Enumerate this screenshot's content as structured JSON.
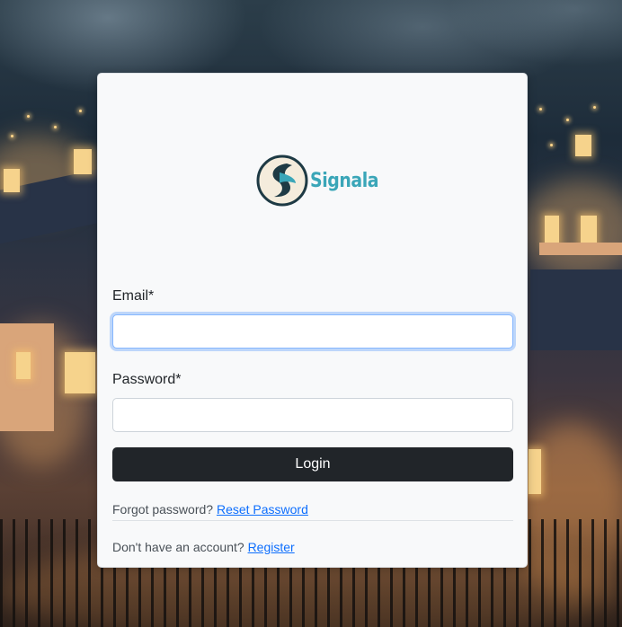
{
  "brand": {
    "name": "Signala",
    "primary_color": "#3aa6b8",
    "dark_color": "#1e3a44"
  },
  "form": {
    "email_label": "Email*",
    "email_value": "",
    "password_label": "Password*",
    "password_value": "",
    "login_label": "Login"
  },
  "links": {
    "forgot_text": "Forgot password?",
    "reset_label": "Reset Password",
    "no_account_text": "Don't have an account?",
    "register_label": "Register"
  },
  "colors": {
    "button_bg": "#212529",
    "link": "#0d6efd",
    "card_bg": "#f8f9fa",
    "focus_ring": "#86b7fe"
  }
}
